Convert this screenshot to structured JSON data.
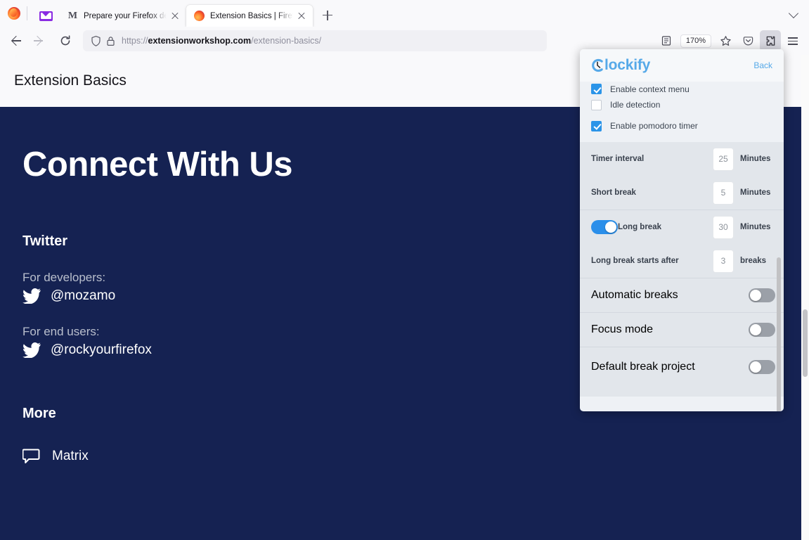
{
  "browser": {
    "tabs": [
      {
        "favicon": "mail-icon",
        "title": "",
        "pinned": true
      },
      {
        "favicon": "matrix-m-icon",
        "title": "Prepare your Firefox desktop ex",
        "pinned": false,
        "active": false
      },
      {
        "favicon": "firefox-icon",
        "title": "Extension Basics | Firefox Extens",
        "pinned": false,
        "active": true
      }
    ],
    "new_tab_label": "+",
    "nav": {
      "back": "back-arrow",
      "forward": "forward-arrow",
      "reload": "reload-arrow"
    },
    "url": {
      "scheme": "https://",
      "host": "extensionworkshop.com",
      "path": "/extension-basics/",
      "shield_icon": "shield-icon",
      "lock_icon": "lock-icon"
    },
    "toolbar": {
      "reader_label": "reader-view-icon",
      "zoom_level": "170%",
      "bookmark_icon": "star-icon",
      "pocket_icon": "pocket-icon",
      "extensions_icon": "extensions-puzzle-icon",
      "menu_icon": "hamburger-menu-icon"
    }
  },
  "page": {
    "header_title": "Extension Basics",
    "hero_title": "Connect With Us",
    "sections": [
      {
        "title": "Twitter",
        "entries": [
          {
            "label": "For developers:",
            "icon": "twitter-icon",
            "handle": "@mozamo"
          },
          {
            "label": "For end users:",
            "icon": "twitter-icon",
            "handle": "@rockyourfirefox"
          }
        ]
      },
      {
        "title": "More",
        "links": [
          {
            "icon": "chat-bubble-icon",
            "text": "Matrix"
          }
        ]
      }
    ],
    "colors": {
      "hero_bg": "#152252",
      "header_bg": "#f9f9fb"
    }
  },
  "popup": {
    "brand": "lockify",
    "brand_mark": "clockify-logo-icon",
    "back_label": "Back",
    "checkboxes": [
      {
        "label": "Enable context menu",
        "checked": true,
        "clipped": true
      },
      {
        "label": "Idle detection",
        "checked": false,
        "clipped": false
      },
      {
        "label": "Enable pomodoro timer",
        "checked": true,
        "clipped": false
      }
    ],
    "timer_fields": [
      {
        "label": "Timer interval",
        "value": "25",
        "unit": "Minutes"
      },
      {
        "label": "Short break",
        "value": "5",
        "unit": "Minutes"
      }
    ],
    "long_break": {
      "toggle_on": true,
      "label": "Long break",
      "value": "30",
      "unit": "Minutes"
    },
    "long_break_after": {
      "label": "Long break starts after",
      "value": "3",
      "unit": "breaks"
    },
    "toggles": [
      {
        "label": "Automatic breaks",
        "on": false
      },
      {
        "label": "Focus mode",
        "on": false
      },
      {
        "label": "Default break project",
        "on": false
      }
    ],
    "accent_color": "#2b8fea",
    "brand_color": "#56a9e8"
  }
}
